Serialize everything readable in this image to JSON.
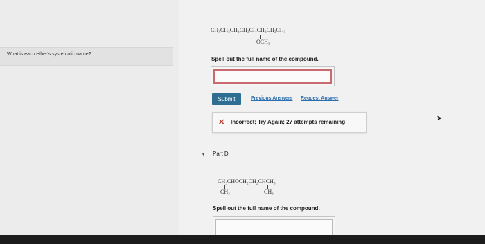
{
  "left": {
    "question": "What is each ether's systematic name?"
  },
  "part_c": {
    "formula_main": "CH₃CH₂CH₂CH₂CHCH₂CH₂CH₃",
    "formula_branch": "OCH₃",
    "prompt": "Spell out the full name of the compound.",
    "answer_value": "",
    "submit_label": "Submit",
    "previous_answers": "Previous Answers",
    "request_answer": "Request Answer",
    "feedback": "Incorrect; Try Again; 27 attempts remaining",
    "feedback_icon": "x-icon"
  },
  "part_d": {
    "label": "Part D",
    "formula_main": "CH₃CHOCH₂CH₂CHCH₃",
    "branch_left": "CH₃",
    "branch_right": "CH₃",
    "prompt": "Spell out the full name of the compound.",
    "answer_value": ""
  },
  "colors": {
    "submit_bg": "#2e6e93",
    "link": "#2b6fb0",
    "error_border": "#c96a6f",
    "error_icon": "#c0392b"
  }
}
